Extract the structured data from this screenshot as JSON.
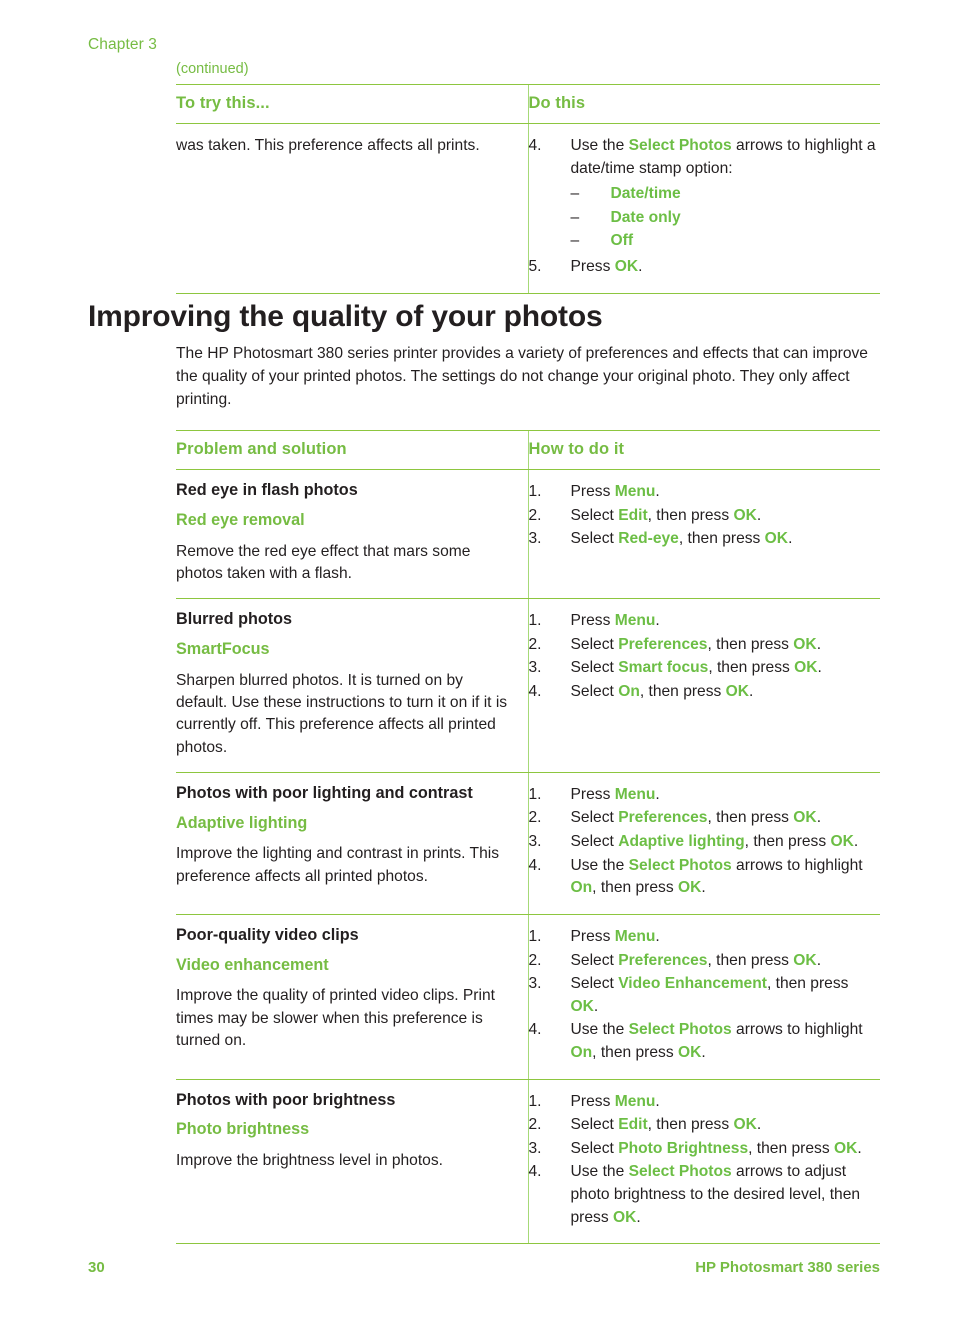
{
  "header": {
    "chapter_label": "Chapter 3",
    "continued_label": "(continued)"
  },
  "table_continued": {
    "headers": {
      "left": "To try this...",
      "right": "Do this"
    },
    "rows": [
      {
        "left_text": "was taken. This preference affects all prints.",
        "steps": [
          {
            "num": "4.",
            "parts": [
              {
                "t": "Use the ",
                "k": false
              },
              {
                "t": "Select Photos",
                "k": true
              },
              {
                "t": " arrows to highlight a date/time stamp option:",
                "k": false
              }
            ],
            "sub": [
              "Date/time",
              "Date only",
              "Off"
            ]
          },
          {
            "num": "5.",
            "parts": [
              {
                "t": "Press ",
                "k": false
              },
              {
                "t": "OK",
                "k": true
              },
              {
                "t": ".",
                "k": false
              }
            ]
          }
        ]
      }
    ]
  },
  "section": {
    "heading": "Improving the quality of your photos",
    "intro": "The HP Photosmart 380 series printer provides a variety of preferences and effects that can improve the quality of your printed photos. The settings do not change your original photo. They only affect printing."
  },
  "table_quality": {
    "headers": {
      "left": "Problem and solution",
      "right": "How to do it"
    },
    "rows": [
      {
        "title": "Red eye in flash photos",
        "feature": "Red eye removal",
        "desc": "Remove the red eye effect that mars some photos taken with a flash.",
        "steps": [
          {
            "num": "1.",
            "parts": [
              {
                "t": "Press ",
                "k": false
              },
              {
                "t": "Menu",
                "k": true
              },
              {
                "t": ".",
                "k": false
              }
            ]
          },
          {
            "num": "2.",
            "parts": [
              {
                "t": "Select ",
                "k": false
              },
              {
                "t": "Edit",
                "k": true
              },
              {
                "t": ", then press ",
                "k": false
              },
              {
                "t": "OK",
                "k": true
              },
              {
                "t": ".",
                "k": false
              }
            ]
          },
          {
            "num": "3.",
            "parts": [
              {
                "t": "Select ",
                "k": false
              },
              {
                "t": "Red-eye",
                "k": true
              },
              {
                "t": ", then press ",
                "k": false
              },
              {
                "t": "OK",
                "k": true
              },
              {
                "t": ".",
                "k": false
              }
            ]
          }
        ]
      },
      {
        "title": "Blurred photos",
        "feature": "SmartFocus",
        "desc": "Sharpen blurred photos. It is turned on by default. Use these instructions to turn it on if it is currently off. This preference affects all printed photos.",
        "steps": [
          {
            "num": "1.",
            "parts": [
              {
                "t": "Press ",
                "k": false
              },
              {
                "t": "Menu",
                "k": true
              },
              {
                "t": ".",
                "k": false
              }
            ]
          },
          {
            "num": "2.",
            "parts": [
              {
                "t": "Select ",
                "k": false
              },
              {
                "t": "Preferences",
                "k": true
              },
              {
                "t": ", then press ",
                "k": false
              },
              {
                "t": "OK",
                "k": true
              },
              {
                "t": ".",
                "k": false
              }
            ]
          },
          {
            "num": "3.",
            "parts": [
              {
                "t": "Select ",
                "k": false
              },
              {
                "t": "Smart focus",
                "k": true
              },
              {
                "t": ", then press ",
                "k": false
              },
              {
                "t": "OK",
                "k": true
              },
              {
                "t": ".",
                "k": false
              }
            ]
          },
          {
            "num": "4.",
            "parts": [
              {
                "t": "Select ",
                "k": false
              },
              {
                "t": "On",
                "k": true
              },
              {
                "t": ", then press ",
                "k": false
              },
              {
                "t": "OK",
                "k": true
              },
              {
                "t": ".",
                "k": false
              }
            ]
          }
        ]
      },
      {
        "title": "Photos with poor lighting and contrast",
        "feature": "Adaptive lighting",
        "desc": "Improve the lighting and contrast in prints. This preference affects all printed photos.",
        "steps": [
          {
            "num": "1.",
            "parts": [
              {
                "t": "Press ",
                "k": false
              },
              {
                "t": "Menu",
                "k": true
              },
              {
                "t": ".",
                "k": false
              }
            ]
          },
          {
            "num": "2.",
            "parts": [
              {
                "t": "Select ",
                "k": false
              },
              {
                "t": "Preferences",
                "k": true
              },
              {
                "t": ", then press ",
                "k": false
              },
              {
                "t": "OK",
                "k": true
              },
              {
                "t": ".",
                "k": false
              }
            ]
          },
          {
            "num": "3.",
            "parts": [
              {
                "t": "Select ",
                "k": false
              },
              {
                "t": "Adaptive lighting",
                "k": true
              },
              {
                "t": ", then press ",
                "k": false
              },
              {
                "t": "OK",
                "k": true
              },
              {
                "t": ".",
                "k": false
              }
            ]
          },
          {
            "num": "4.",
            "parts": [
              {
                "t": "Use the ",
                "k": false
              },
              {
                "t": "Select Photos",
                "k": true
              },
              {
                "t": " arrows to highlight ",
                "k": false
              },
              {
                "t": "On",
                "k": true
              },
              {
                "t": ", then press ",
                "k": false
              },
              {
                "t": "OK",
                "k": true
              },
              {
                "t": ".",
                "k": false
              }
            ]
          }
        ]
      },
      {
        "title": "Poor-quality video clips",
        "feature": "Video enhancement",
        "desc": "Improve the quality of printed video clips. Print times may be slower when this preference is turned on.",
        "steps": [
          {
            "num": "1.",
            "parts": [
              {
                "t": "Press ",
                "k": false
              },
              {
                "t": "Menu",
                "k": true
              },
              {
                "t": ".",
                "k": false
              }
            ]
          },
          {
            "num": "2.",
            "parts": [
              {
                "t": "Select ",
                "k": false
              },
              {
                "t": "Preferences",
                "k": true
              },
              {
                "t": ", then press ",
                "k": false
              },
              {
                "t": "OK",
                "k": true
              },
              {
                "t": ".",
                "k": false
              }
            ]
          },
          {
            "num": "3.",
            "parts": [
              {
                "t": "Select ",
                "k": false
              },
              {
                "t": "Video Enhancement",
                "k": true
              },
              {
                "t": ", then press ",
                "k": false
              },
              {
                "t": "OK",
                "k": true
              },
              {
                "t": ".",
                "k": false
              }
            ]
          },
          {
            "num": "4.",
            "parts": [
              {
                "t": "Use the ",
                "k": false
              },
              {
                "t": "Select Photos",
                "k": true
              },
              {
                "t": " arrows to highlight ",
                "k": false
              },
              {
                "t": "On",
                "k": true
              },
              {
                "t": ", then press ",
                "k": false
              },
              {
                "t": "OK",
                "k": true
              },
              {
                "t": ".",
                "k": false
              }
            ]
          }
        ]
      },
      {
        "title": "Photos with poor brightness",
        "feature": "Photo brightness",
        "desc": "Improve the brightness level in photos.",
        "steps": [
          {
            "num": "1.",
            "parts": [
              {
                "t": "Press ",
                "k": false
              },
              {
                "t": "Menu",
                "k": true
              },
              {
                "t": ".",
                "k": false
              }
            ]
          },
          {
            "num": "2.",
            "parts": [
              {
                "t": "Select ",
                "k": false
              },
              {
                "t": "Edit",
                "k": true
              },
              {
                "t": ", then press ",
                "k": false
              },
              {
                "t": "OK",
                "k": true
              },
              {
                "t": ".",
                "k": false
              }
            ]
          },
          {
            "num": "3.",
            "parts": [
              {
                "t": "Select ",
                "k": false
              },
              {
                "t": "Photo Brightness",
                "k": true
              },
              {
                "t": ", then press ",
                "k": false
              },
              {
                "t": "OK",
                "k": true
              },
              {
                "t": ".",
                "k": false
              }
            ]
          },
          {
            "num": "4.",
            "parts": [
              {
                "t": "Use the ",
                "k": false
              },
              {
                "t": "Select Photos",
                "k": true
              },
              {
                "t": " arrows to adjust photo brightness to the desired level, then press ",
                "k": false
              },
              {
                "t": "OK",
                "k": true
              },
              {
                "t": ".",
                "k": false
              }
            ]
          }
        ]
      }
    ]
  },
  "footer": {
    "page_number": "30",
    "product": "HP Photosmart 380 series"
  },
  "colors": {
    "accent_green": "#76bc43",
    "keyword_green": "#6cbe45",
    "rule_green": "#8dc63f",
    "text_black": "#231f20"
  }
}
